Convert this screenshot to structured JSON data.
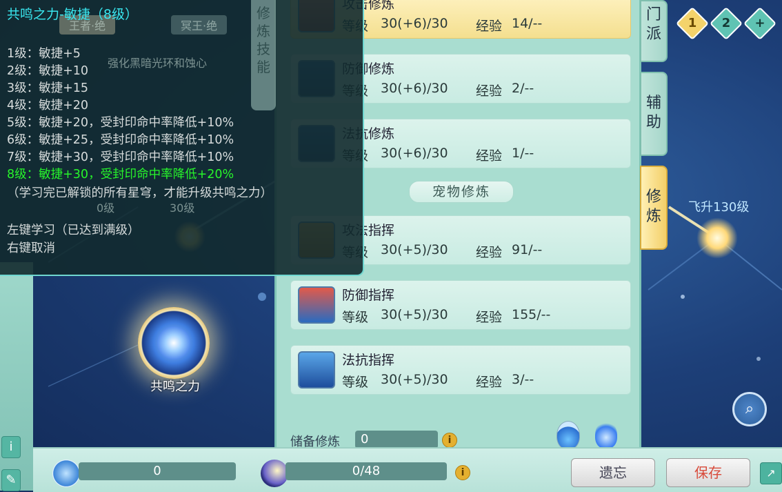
{
  "tooltip": {
    "title": "共鸣之力-敏捷（8级）",
    "lines": [
      "1级：敏捷+5",
      "2级：敏捷+10",
      "3级：敏捷+15",
      "4级：敏捷+20",
      "5级：敏捷+20，受封印命中率降低+10%",
      "6级：敏捷+25，受封印命中率降低+10%",
      "7级：敏捷+30，受封印命中率降低+10%",
      "8级：敏捷+30，受封印命中率降低+20%"
    ],
    "highlight_index": 7,
    "note": "（学习完已解锁的所有星穹，才能升级共鸣之力）",
    "action_left": "左键学习（已达到满级）",
    "action_right": "右键取消",
    "bg_tab_1": "王者·绝",
    "bg_tab_2": "冥王·绝",
    "bg_desc": "强化黑暗光环和蚀心",
    "bg_tick_1": "0级",
    "bg_tick_2": "30级",
    "side_tab": "修炼技能"
  },
  "scene": {
    "resonance_label": "共鸣之力",
    "fly_label": "飞升130级"
  },
  "badges": [
    "1",
    "2",
    "+"
  ],
  "tabs": [
    "门派",
    "辅助",
    "修炼"
  ],
  "panel": {
    "level_label": "等级",
    "exp_label": "经验",
    "rows_top": [
      {
        "name": "攻击修炼",
        "level": "30(+6)/30",
        "exp": "14/--",
        "selected": true,
        "icon": "sword-icon"
      },
      {
        "name": "防御修炼",
        "level": "30(+6)/30",
        "exp": "2/--",
        "icon": "shield-icon"
      },
      {
        "name": "法抗修炼",
        "level": "30(+6)/30",
        "exp": "1/--",
        "icon": "magic-shield-icon"
      }
    ],
    "section_title": "宠物修炼",
    "rows_pet": [
      {
        "name": "攻法指挥",
        "level": "30(+5)/30",
        "exp": "91/--",
        "icon": "paw-attack-icon"
      },
      {
        "name": "防御指挥",
        "level": "30(+5)/30",
        "exp": "155/--",
        "icon": "paw-shield-icon"
      },
      {
        "name": "法抗指挥",
        "level": "30(+5)/30",
        "exp": "3/--",
        "icon": "paw-magic-icon"
      }
    ],
    "reserve_label": "储备修炼",
    "reserve_value": "0"
  },
  "bottom": {
    "points_value": "0",
    "progress_text": "0/48",
    "forget_button": "遗忘",
    "save_button": "保存"
  },
  "colors": {
    "tooltip_title": "#39e7ef",
    "highlight": "#27f52b",
    "save_text": "#d84a3a"
  }
}
